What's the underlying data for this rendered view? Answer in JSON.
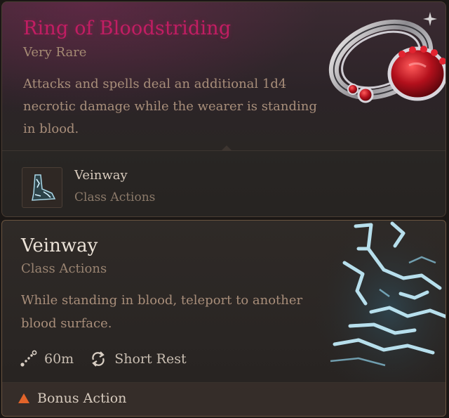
{
  "item": {
    "name": "Ring of Bloodstriding",
    "rarity": "Very Rare",
    "description": "Attacks and spells deal an additional 1d4 necrotic damage while the wearer is standing in blood.",
    "name_color": "#c21d63",
    "image_icon": "ruby-ring-icon",
    "granted_action": {
      "name": "Veinway",
      "type": "Class Actions",
      "icon": "veinway-icon"
    }
  },
  "spell": {
    "name": "Veinway",
    "type": "Class Actions",
    "description": "While standing in blood, teleport to another blood surface.",
    "image_icon": "veinway-art-icon",
    "stats": {
      "range": "60m",
      "range_icon": "range-icon",
      "recharge": "Short Rest",
      "recharge_icon": "recharge-icon"
    },
    "cost": {
      "label": "Bonus Action",
      "icon": "bonus-action-triangle-icon",
      "icon_color": "#e2642a"
    }
  }
}
